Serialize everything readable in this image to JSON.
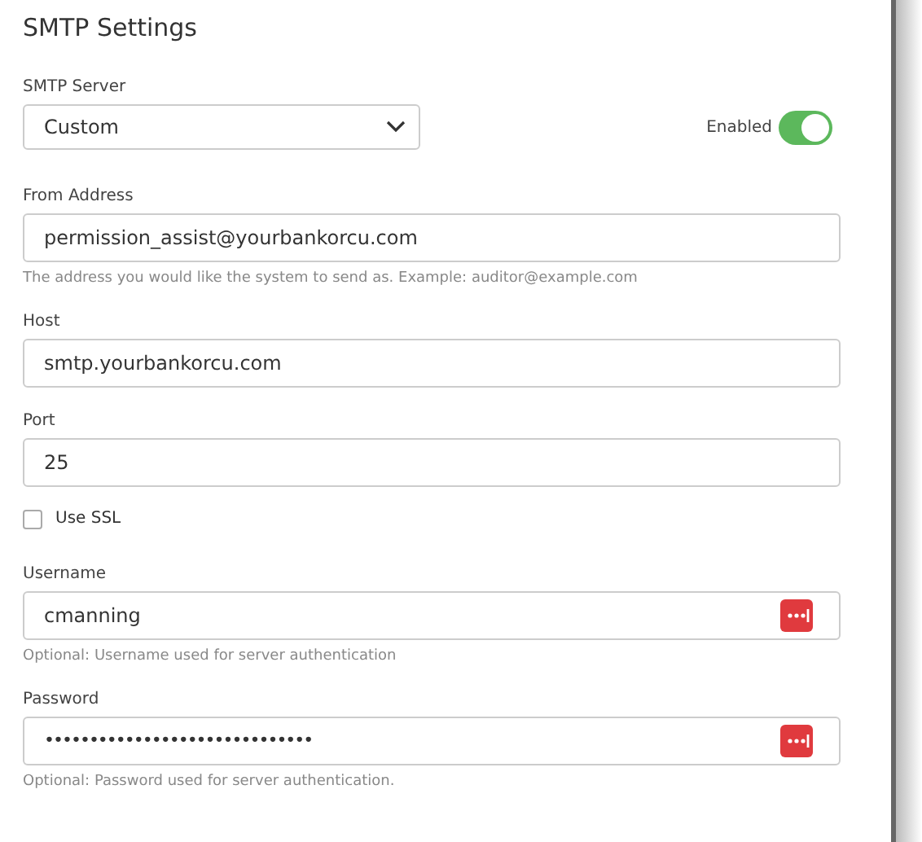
{
  "title": "SMTP Settings",
  "server": {
    "label": "SMTP Server",
    "value": "Custom"
  },
  "enabled": {
    "label": "Enabled",
    "on": true
  },
  "fields": [
    {
      "kind": "text",
      "label": "From Address",
      "value": "permission_assist@yourbankorcu.com",
      "help": "The address you would like the system to send as. Example: auditor@example.com"
    },
    {
      "kind": "text",
      "label": "Host",
      "value": "smtp.yourbankorcu.com"
    },
    {
      "kind": "text",
      "label": "Port",
      "value": "25"
    },
    {
      "kind": "checkbox",
      "label": "Use SSL",
      "checked": false
    },
    {
      "kind": "secret",
      "label": "Username",
      "value": "cmanning",
      "help": "Optional: Username used for server authentication"
    },
    {
      "kind": "secret",
      "label": "Password",
      "value": "••••••••••••••••••••••••••••••",
      "help": "Optional: Password used for server authentication."
    }
  ]
}
